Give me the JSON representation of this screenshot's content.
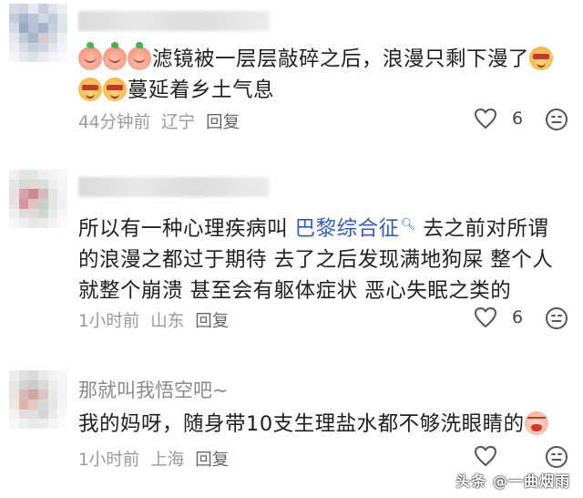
{
  "comments": [
    {
      "name": "",
      "body_line1": "滤镜被一层层敲碎之后，浪漫只剩下漫了",
      "body_line2": "蔓延着乡土气息",
      "time": "44分钟前",
      "location": "辽宁",
      "reply_label": "回复",
      "likes": "6"
    },
    {
      "name": "",
      "body_prefix": "所以有一种心理疾病叫",
      "link_text": "巴黎综合征",
      "body_suffix_line1": "去之前对所谓",
      "body_line2": "的浪漫之都过于期待 去了之后发现满地狗屎 整个人",
      "body_line3": "就整个崩溃 甚至会有躯体症状 恶心失眠之类的",
      "time": "1小时前",
      "location": "山东",
      "reply_label": "回复",
      "likes": "6"
    },
    {
      "name": "那就叫我悟空吧~",
      "body_line1": "我的妈呀，随身带10支生理盐水都不够洗眼睛的",
      "time": "1小时前",
      "location": "上海",
      "reply_label": "回复",
      "likes": ""
    }
  ],
  "icons": {
    "heart": "heart-icon",
    "face": "emoji-face-icon",
    "search": "search-icon",
    "peach_emoji": "peach-emoji-icon",
    "dog_emoji": "dog-emoji-icon",
    "cry_emoji": "crying-emoji-icon"
  },
  "watermark": "头条 @一曲烟雨",
  "colors": {
    "link": "#2f5fb3",
    "meta": "#9a9a9a"
  }
}
